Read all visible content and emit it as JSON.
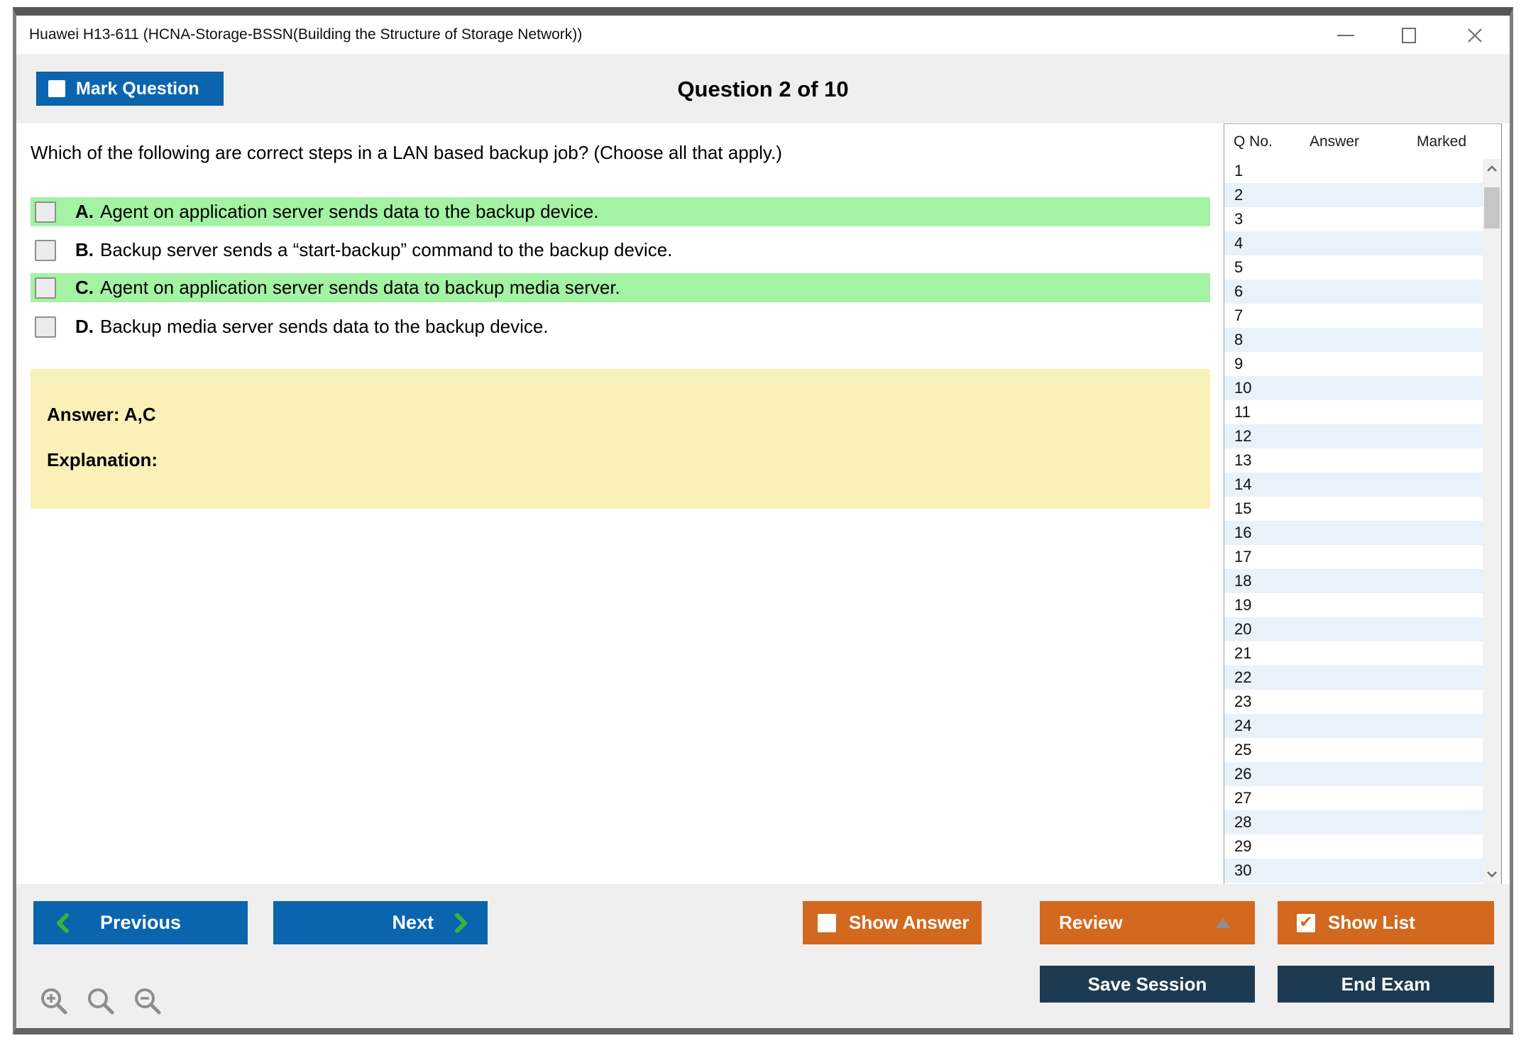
{
  "window": {
    "title": "Huawei H13-611 (HCNA-Storage-BSSN(Building the Structure of Storage Network))"
  },
  "header": {
    "mark_question_label": "Mark Question",
    "question_counter": "Question 2 of 10"
  },
  "question": {
    "text": "Which of the following are correct steps in a LAN based backup job? (Choose all that apply.)",
    "options": [
      {
        "letter": "A.",
        "text": "Agent on application server sends data to the backup device.",
        "highlighted": true,
        "checked": false
      },
      {
        "letter": "B.",
        "text": "Backup server sends a “start-backup” command to the backup device.",
        "highlighted": false,
        "checked": false
      },
      {
        "letter": "C.",
        "text": "Agent on application server sends data to backup media server.",
        "highlighted": true,
        "checked": false
      },
      {
        "letter": "D.",
        "text": "Backup media server sends data to the backup device.",
        "highlighted": false,
        "checked": false
      }
    ],
    "answer_label": "Answer: A,C",
    "explanation_label": "Explanation:"
  },
  "sidebar": {
    "columns": [
      "Q No.",
      "Answer",
      "Marked"
    ],
    "rows": [
      1,
      2,
      3,
      4,
      5,
      6,
      7,
      8,
      9,
      10,
      11,
      12,
      13,
      14,
      15,
      16,
      17,
      18,
      19,
      20,
      21,
      22,
      23,
      24,
      25,
      26,
      27,
      28,
      29,
      30
    ]
  },
  "footer": {
    "previous_label": "Previous",
    "next_label": "Next",
    "show_answer_label": "Show Answer",
    "review_label": "Review",
    "show_list_label": "Show List",
    "save_session_label": "Save Session",
    "end_exam_label": "End Exam"
  },
  "colors": {
    "accent_blue": "#0a65ae",
    "accent_orange": "#d2691e",
    "dark_navy": "#1d3a50",
    "highlight_green": "#a4f2a4",
    "answer_yellow": "#faf1b8",
    "chevron_green": "#35b43c"
  }
}
